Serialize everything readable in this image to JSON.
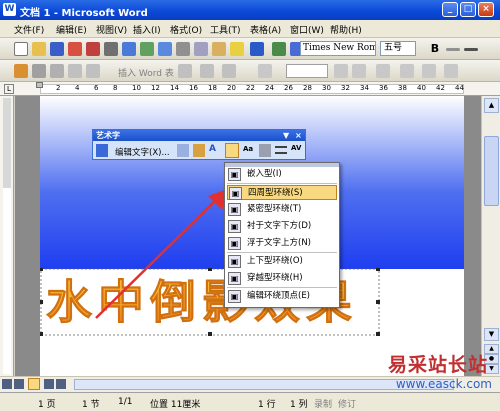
{
  "window": {
    "title": "文档 1 - Microsoft Word"
  },
  "menu": [
    "文件(F)",
    "编辑(E)",
    "视图(V)",
    "插入(I)",
    "格式(O)",
    "工具(T)",
    "表格(A)",
    "窗口(W)",
    "帮助(H)"
  ],
  "formatting": {
    "font": "Times New Roman",
    "size": "五号",
    "bold": "B"
  },
  "toolbar3": {
    "insert_wordart": "插入 Word 表"
  },
  "ruler": {
    "labels": [
      "2",
      "4",
      "6",
      "8",
      "10",
      "12",
      "14",
      "16",
      "18",
      "20",
      "22",
      "24",
      "26",
      "28",
      "30",
      "32",
      "34",
      "36",
      "38",
      "40",
      "42",
      "44"
    ]
  },
  "wordart_toolbar": {
    "title": "艺术字",
    "edit_text": "编辑文字(X)..."
  },
  "wrap_menu": {
    "items": [
      {
        "label": "嵌入型(I)",
        "icon": "inline-wrap-icon"
      },
      {
        "label": "四周型环绕(S)",
        "icon": "square-wrap-icon"
      },
      {
        "label": "紧密型环绕(T)",
        "icon": "tight-wrap-icon"
      },
      {
        "label": "衬于文字下方(D)",
        "icon": "behind-text-icon"
      },
      {
        "label": "浮于文字上方(N)",
        "icon": "in-front-text-icon"
      },
      {
        "label": "上下型环绕(O)",
        "icon": "top-bottom-wrap-icon"
      },
      {
        "label": "穿越型环绕(H)",
        "icon": "through-wrap-icon"
      },
      {
        "label": "编辑环绕顶点(E)",
        "icon": "edit-wrap-points-icon"
      }
    ]
  },
  "wordart_text": "水中倒影效果",
  "status": {
    "page": "1 页",
    "section": "1 节",
    "pages": "1/1",
    "position": "位置 11厘米",
    "line": "1 行",
    "col": "1 列",
    "rec": "录制",
    "trk": "修订"
  },
  "watermark": {
    "text": "易采站长站",
    "url": "www.easck.com"
  },
  "colors": {
    "title_bar": "#0a48d6",
    "highlight": "#f8d880",
    "wordart_fill": "#f0a020"
  }
}
